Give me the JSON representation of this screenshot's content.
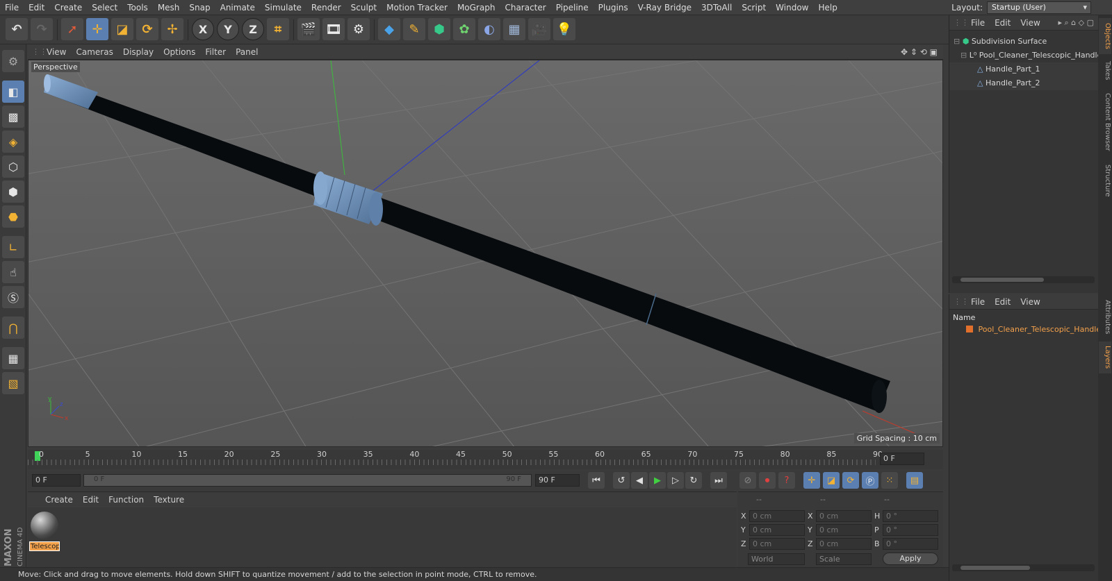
{
  "menubar": {
    "items": [
      "File",
      "Edit",
      "Create",
      "Select",
      "Tools",
      "Mesh",
      "Snap",
      "Animate",
      "Simulate",
      "Render",
      "Sculpt",
      "Motion Tracker",
      "MoGraph",
      "Character",
      "Pipeline",
      "Plugins",
      "V-Ray Bridge",
      "3DToAll",
      "Script",
      "Window",
      "Help"
    ],
    "layout_label": "Layout:",
    "layout_value": "Startup (User)"
  },
  "viewport": {
    "menu": [
      "View",
      "Cameras",
      "Display",
      "Options",
      "Filter",
      "Panel"
    ],
    "label": "Perspective",
    "grid_spacing": "Grid Spacing : 10 cm"
  },
  "timeline": {
    "ticks": [
      "0",
      "5",
      "10",
      "15",
      "20",
      "25",
      "30",
      "35",
      "40",
      "45",
      "50",
      "55",
      "60",
      "65",
      "70",
      "75",
      "80",
      "85",
      "90"
    ],
    "current_frame_display": "0 F"
  },
  "playback": {
    "start_field": "0 F",
    "slider_start": "0 F",
    "slider_end": "90 F",
    "end_field": "90 F"
  },
  "materials": {
    "menu": [
      "Create",
      "Edit",
      "Function",
      "Texture"
    ],
    "material_name": "Telescop"
  },
  "coordinates": {
    "header": [
      "--",
      "--",
      "--"
    ],
    "rows": [
      {
        "l1": "X",
        "v1": "0 cm",
        "l2": "X",
        "v2": "0 cm",
        "l3": "H",
        "v3": "0 °"
      },
      {
        "l1": "Y",
        "v1": "0 cm",
        "l2": "Y",
        "v2": "0 cm",
        "l3": "P",
        "v3": "0 °"
      },
      {
        "l1": "Z",
        "v1": "0 cm",
        "l2": "Z",
        "v2": "0 cm",
        "l3": "B",
        "v3": "0 °"
      }
    ],
    "mode_world": "World",
    "mode_scale": "Scale",
    "apply_label": "Apply"
  },
  "objects_panel": {
    "menu": [
      "File",
      "Edit",
      "View"
    ],
    "tree": [
      "Subdivision Surface",
      "Pool_Cleaner_Telescopic_Handle",
      "Handle_Part_1",
      "Handle_Part_2"
    ]
  },
  "layers_panel": {
    "menu": [
      "File",
      "Edit",
      "View"
    ],
    "column_header": "Name",
    "row": "Pool_Cleaner_Telescopic_Handle"
  },
  "side_tabs": [
    "Objects",
    "Takes",
    "Content Browser",
    "Structure",
    "Attributes",
    "Layers"
  ],
  "logo": {
    "brand": "MAXON",
    "product": "CINEMA 4D"
  },
  "status": "Move: Click and drag to move elements. Hold down SHIFT to quantize movement / add to the selection in point mode, CTRL to remove.",
  "colors": {
    "accent": "#5b7fb1",
    "selection": "#f4a14b",
    "handle": "#080c10",
    "connector": "#6f8fb3"
  }
}
